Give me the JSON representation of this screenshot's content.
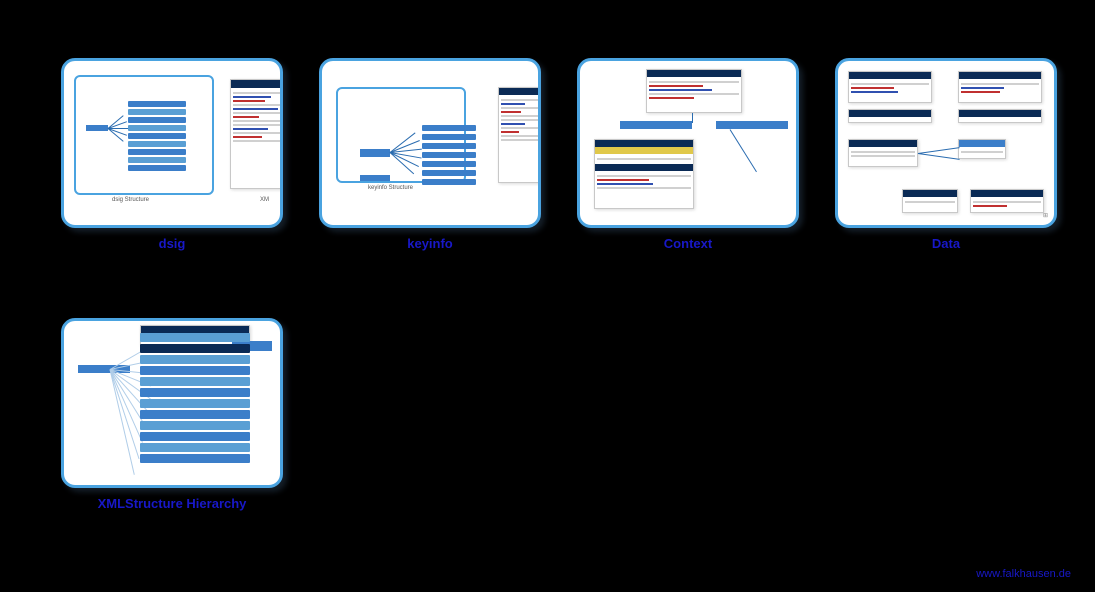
{
  "cards": [
    {
      "key": "dsig",
      "label": "dsig",
      "inner_label": "dsig Structure",
      "xml_label": "XM"
    },
    {
      "key": "keyinfo",
      "label": "keyinfo",
      "inner_label": "keyinfo Structure"
    },
    {
      "key": "context",
      "label": "Context"
    },
    {
      "key": "data",
      "label": "Data"
    },
    {
      "key": "xmlstructure",
      "label": "XMLStructure Hierarchy"
    }
  ],
  "footer": {
    "url": "www.falkhausen.de"
  }
}
